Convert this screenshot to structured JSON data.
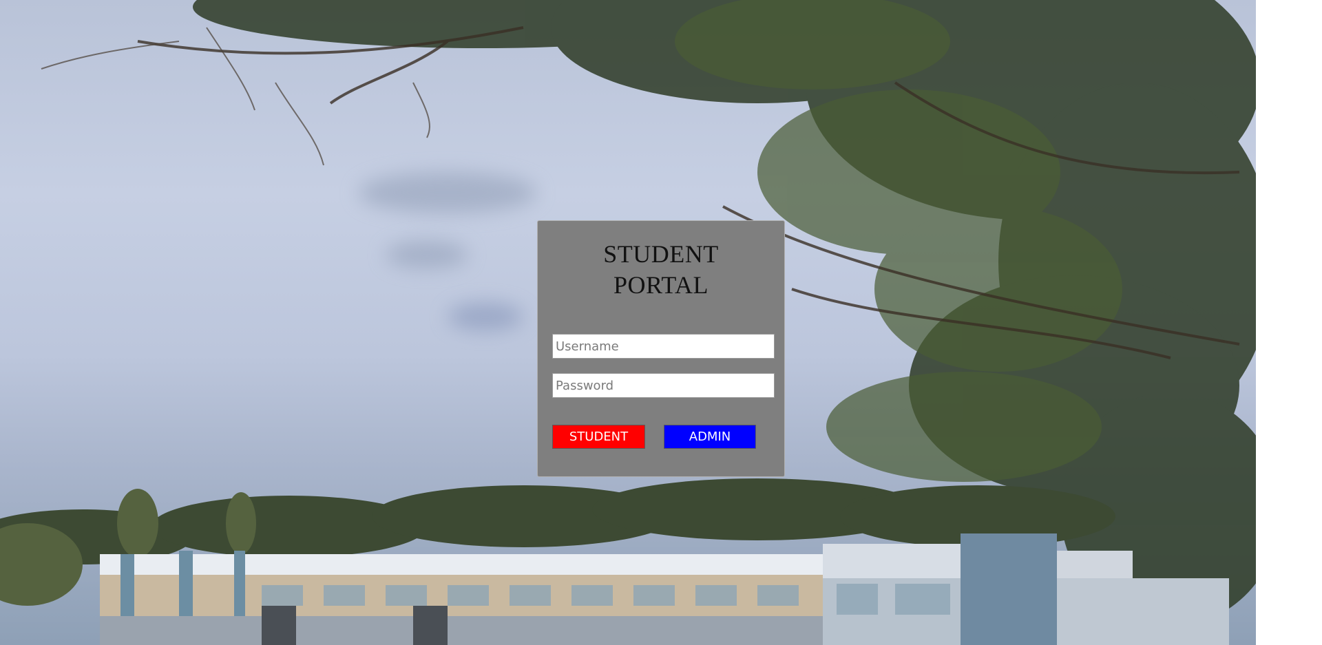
{
  "page": {
    "background_description_icon": "campus-background-icon"
  },
  "login": {
    "title_line1": "STUDENT",
    "title_line2": "PORTAL",
    "username_placeholder": "Username",
    "password_placeholder": "Password",
    "username_value": "",
    "password_value": "",
    "student_button_label": "STUDENT",
    "admin_button_label": "ADMIN"
  },
  "colors": {
    "panel": "#7f7f7f",
    "student_button": "#ff0000",
    "admin_button": "#0000ff"
  }
}
